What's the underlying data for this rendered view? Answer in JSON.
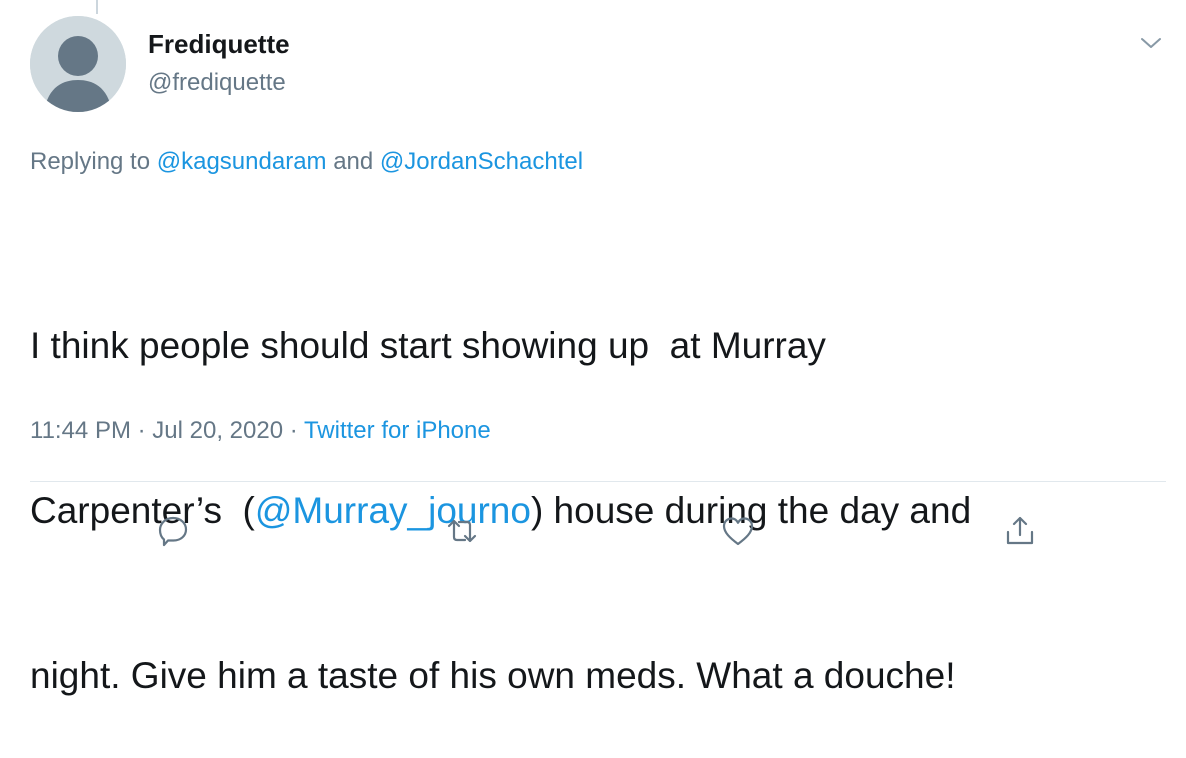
{
  "user": {
    "display_name": "Frediquette",
    "handle": "@frediquette"
  },
  "reply": {
    "prefix": "Replying to ",
    "mention1": "@kagsundaram",
    "joiner": " and ",
    "mention2": "@JordanSchachtel"
  },
  "tweet": {
    "line1": "I think people should start showing up  at Murray",
    "line2_before": "Carpenter’s  (",
    "line2_mention": "@Murray_journo",
    "line2_after": ") house during the day and",
    "line3": "night. Give him a taste of his own meds. What a douche!"
  },
  "meta": {
    "time": "11:44 PM",
    "sep1": " · ",
    "date": "Jul 20, 2020",
    "sep2": " · ",
    "source": "Twitter for iPhone"
  },
  "icons": {
    "avatar": "default-avatar-icon",
    "menu": "chevron-down-icon",
    "reply": "reply-bubble-icon",
    "retweet": "retweet-icon",
    "like": "heart-icon",
    "share": "share-icon"
  },
  "colors": {
    "link": "#1b95e0",
    "secondary_text": "#657786",
    "primary_text": "#14171a",
    "icon": "#657786",
    "divider": "#e1e8ed"
  }
}
